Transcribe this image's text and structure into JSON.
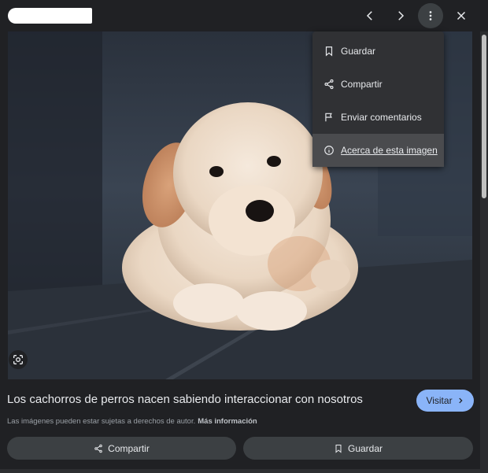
{
  "header": {
    "prev_icon": "chevron-left-icon",
    "next_icon": "chevron-right-icon",
    "more_icon": "more-vertical-icon",
    "close_icon": "close-icon"
  },
  "menu": {
    "items": [
      {
        "label": "Guardar",
        "icon": "bookmark-icon"
      },
      {
        "label": "Compartir",
        "icon": "share-icon"
      },
      {
        "label": "Enviar comentarios",
        "icon": "flag-icon"
      },
      {
        "label": "Acerca de esta imagen",
        "icon": "info-icon"
      }
    ]
  },
  "image": {
    "alt": "Cachorro de golden retriever",
    "lens_icon": "lens-icon"
  },
  "result": {
    "title": "Los cachorros de perros nacen sabiendo interaccionar con nosotros",
    "visit_label": "Visitar",
    "copyright_text": "Las imágenes pueden estar sujetas a derechos de autor.",
    "more_info_label": "Más información"
  },
  "actions": {
    "share_label": "Compartir",
    "save_label": "Guardar"
  },
  "colors": {
    "background": "#202124",
    "menu_bg": "#303134",
    "accent": "#8ab4f8",
    "button_bg": "#3c4043"
  }
}
